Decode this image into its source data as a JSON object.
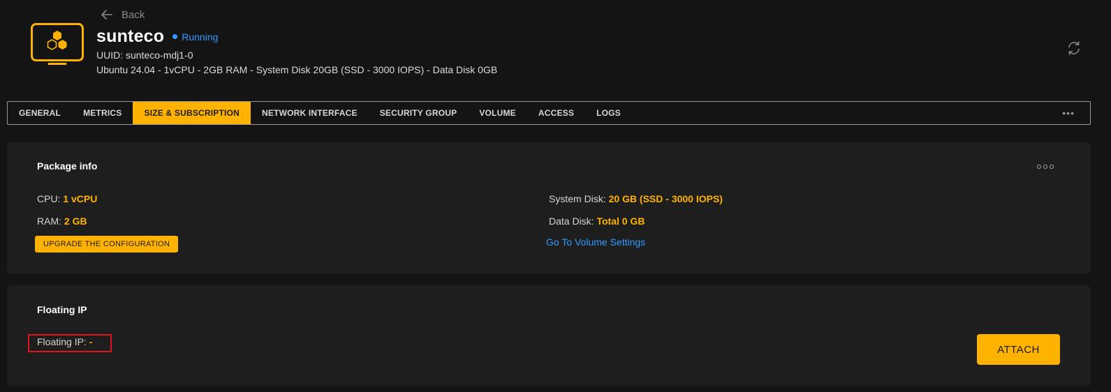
{
  "header": {
    "back_label": "Back",
    "vm_name": "sunteco",
    "status": "Running",
    "uuid": "UUID: sunteco-mdj1-0",
    "specs": "Ubuntu 24.04 - 1vCPU - 2GB RAM - System Disk 20GB (SSD - 3000 IOPS) - Data Disk 0GB",
    "icons": [
      "arrow-left-icon",
      "vm-monitor-icon",
      "refresh-icon"
    ]
  },
  "tabs": [
    {
      "label": "GENERAL",
      "active": false
    },
    {
      "label": "METRICS",
      "active": false
    },
    {
      "label": "SIZE & SUBSCRIPTION",
      "active": true
    },
    {
      "label": "NETWORK INTERFACE",
      "active": false
    },
    {
      "label": "SECURITY GROUP",
      "active": false
    },
    {
      "label": "VOLUME",
      "active": false
    },
    {
      "label": "ACCESS",
      "active": false
    },
    {
      "label": "LOGS",
      "active": false
    }
  ],
  "package_info": {
    "title": "Package info",
    "cpu_label": "CPU:",
    "cpu_value": "1 vCPU",
    "ram_label": "RAM:",
    "ram_value": "2 GB",
    "system_disk_label": "System Disk:",
    "system_disk_value": "20 GB (SSD - 3000 IOPS)",
    "data_disk_label": "Data Disk:",
    "data_disk_value": "Total 0 GB",
    "upgrade_button": "UPGRADE THE CONFIGURATION",
    "volume_link": "Go To Volume Settings"
  },
  "floating_ip": {
    "title": "Floating IP",
    "label": "Floating IP:",
    "value": "-",
    "attach_button": "ATTACH"
  },
  "colors": {
    "background": "#141414",
    "card": "#1e1e1e",
    "accent": "#ffb300",
    "link": "#2f9bff",
    "highlight_border": "#e0141e"
  }
}
